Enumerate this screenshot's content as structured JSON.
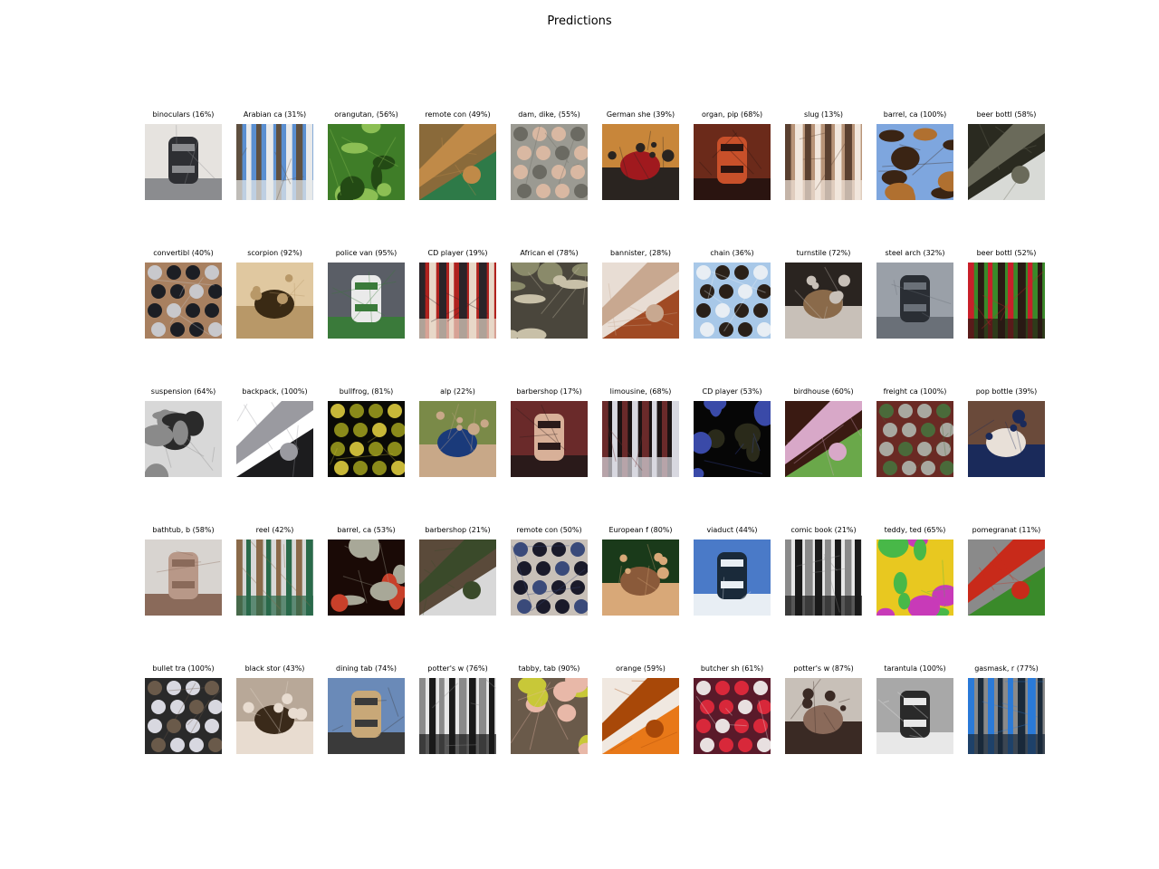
{
  "figure": {
    "title": "Predictions"
  },
  "rows": [
    {
      "items": [
        {
          "label": "binoculars (16%)",
          "image": "binoculars",
          "colors": [
            "#e6e3df",
            "#2e2f33",
            "#8b8c8f"
          ]
        },
        {
          "label": "Arabian ca (31%)",
          "image": "camel-in-desert",
          "colors": [
            "#5a8fd1",
            "#e8e9ea",
            "#5f5040"
          ]
        },
        {
          "label": "orangutan, (56%)",
          "image": "green-pepper-plant",
          "colors": [
            "#3f7d28",
            "#234a14",
            "#8cbf54"
          ]
        },
        {
          "label": "remote con (49%)",
          "image": "man-at-tower",
          "colors": [
            "#8a6a3a",
            "#2e7a48",
            "#c08a48"
          ]
        },
        {
          "label": "dam, dike, (55%)",
          "image": "hand-over-water",
          "colors": [
            "#9b9a92",
            "#d9b8a2",
            "#6b6a62"
          ]
        },
        {
          "label": "German she (39%)",
          "image": "costume-figure",
          "colors": [
            "#c8863a",
            "#a0191e",
            "#2a2420"
          ]
        },
        {
          "label": "organ, pip (68%)",
          "image": "wine-cellar",
          "colors": [
            "#6b2a1a",
            "#c8502a",
            "#2a1410"
          ]
        },
        {
          "label": "slug (13%)",
          "image": "wicker-basket",
          "colors": [
            "#b89478",
            "#f1e6dc",
            "#5a4030"
          ]
        },
        {
          "label": "barrel, ca (100%)",
          "image": "barrel",
          "colors": [
            "#7ea6de",
            "#b07030",
            "#3a2414"
          ]
        },
        {
          "label": "beer bottl (58%)",
          "image": "bottle",
          "colors": [
            "#2a2a20",
            "#d8dad6",
            "#6a6a5a"
          ]
        }
      ]
    },
    {
      "items": [
        {
          "label": "convertibl (40%)",
          "image": "convertible-car",
          "colors": [
            "#a88060",
            "#1c1e24",
            "#c8c8cc"
          ]
        },
        {
          "label": "scorpion (92%)",
          "image": "scorpion",
          "colors": [
            "#e0c8a0",
            "#3a2a14",
            "#b89868"
          ]
        },
        {
          "label": "police van (95%)",
          "image": "van",
          "colors": [
            "#5a5e66",
            "#eaeaea",
            "#3a7a3a"
          ]
        },
        {
          "label": "CD player (19%)",
          "image": "hands-with-cds",
          "colors": [
            "#b0221e",
            "#e8d8c8",
            "#2a2428"
          ]
        },
        {
          "label": "African el (78%)",
          "image": "elephant",
          "colors": [
            "#4a463c",
            "#8a8a6a",
            "#c8c0a8"
          ]
        },
        {
          "label": "bannister, (28%)",
          "image": "wooden-sticks",
          "colors": [
            "#e8ddd4",
            "#a04a24",
            "#c8a890"
          ]
        },
        {
          "label": "chain (36%)",
          "image": "sandals",
          "colors": [
            "#a8c8e8",
            "#2a2018",
            "#e8eef4"
          ]
        },
        {
          "label": "turnstile (72%)",
          "image": "shutter-gate",
          "colors": [
            "#2a2420",
            "#8a6a4a",
            "#c8c0b8"
          ]
        },
        {
          "label": "steel arch (32%)",
          "image": "steel-bridge",
          "colors": [
            "#9aa0a8",
            "#2a2e34",
            "#6a7078"
          ]
        },
        {
          "label": "beer bottl (52%)",
          "image": "soda-bottle",
          "colors": [
            "#3a8a2a",
            "#2a1a14",
            "#c8202a"
          ]
        }
      ]
    },
    {
      "items": [
        {
          "label": "suspension (64%)",
          "image": "suspension-bridge",
          "colors": [
            "#d8d8d8",
            "#2a2a2a",
            "#8a8a8a"
          ]
        },
        {
          "label": "backpack,  (100%)",
          "image": "shoulder-bag",
          "colors": [
            "#ffffff",
            "#1c1c1e",
            "#9a9aa0"
          ]
        },
        {
          "label": "bullfrog,  (81%)",
          "image": "frog-on-leaf",
          "colors": [
            "#0a0a06",
            "#8a8a1a",
            "#c8b838"
          ]
        },
        {
          "label": "alp (22%)",
          "image": "man-with-binoculars",
          "colors": [
            "#7a8a48",
            "#1a3a7a",
            "#c8a888"
          ]
        },
        {
          "label": "barbershop (17%)",
          "image": "crowd",
          "colors": [
            "#6a2a2a",
            "#d8b098",
            "#2a1a1a"
          ]
        },
        {
          "label": "limousine, (68%)",
          "image": "night-car",
          "colors": [
            "#1a1212",
            "#d8d8e0",
            "#6a2a2a"
          ]
        },
        {
          "label": "CD player (53%)",
          "image": "dark-stereo",
          "colors": [
            "#060606",
            "#2a2a1a",
            "#3a4aa8"
          ]
        },
        {
          "label": "birdhouse (60%)",
          "image": "birdhouse",
          "colors": [
            "#3a1a12",
            "#6aa84a",
            "#d8a8c8"
          ]
        },
        {
          "label": "freight ca (100%)",
          "image": "freight-car",
          "colors": [
            "#6a2a24",
            "#a8a8a0",
            "#4a6a3a"
          ]
        },
        {
          "label": "pop bottle (39%)",
          "image": "bottles-on-shelf",
          "colors": [
            "#6a4a3a",
            "#e8e0d8",
            "#1a2a5a"
          ]
        }
      ]
    },
    {
      "items": [
        {
          "label": "bathtub, b (58%)",
          "image": "dogs-in-tub",
          "colors": [
            "#d8d4d0",
            "#b89888",
            "#8a6a5a"
          ]
        },
        {
          "label": "reel (42%)",
          "image": "green-cart",
          "colors": [
            "#d8d8d8",
            "#2a6a4a",
            "#8a6a4a"
          ]
        },
        {
          "label": "barrel, ca (53%)",
          "image": "bar-counter",
          "colors": [
            "#1a0a06",
            "#c8402a",
            "#a8a898"
          ]
        },
        {
          "label": "barbershop (21%)",
          "image": "people-crowd",
          "colors": [
            "#5a4a3a",
            "#d8d8d8",
            "#3a4a2a"
          ]
        },
        {
          "label": "remote con (50%)",
          "image": "mp3-player",
          "colors": [
            "#c8c0b8",
            "#1a1a2a",
            "#3a4a7a"
          ]
        },
        {
          "label": "European f (80%)",
          "image": "spider-on-log",
          "colors": [
            "#1a3a1a",
            "#8a5a3a",
            "#d8a878"
          ]
        },
        {
          "label": "viaduct (44%)",
          "image": "bridge-underside",
          "colors": [
            "#4a7ac8",
            "#1a2a3a",
            "#e8eef4"
          ]
        },
        {
          "label": "comic book (21%)",
          "image": "old-photo",
          "colors": [
            "#e8e8e8",
            "#1a1a1a",
            "#8a8a8a"
          ]
        },
        {
          "label": "teddy, ted (65%)",
          "image": "candle-toy",
          "colors": [
            "#e8c820",
            "#c83ab8",
            "#48b848"
          ]
        },
        {
          "label": "pomegranat (11%)",
          "image": "tomato-plant",
          "colors": [
            "#8a8a8a",
            "#3a8a2a",
            "#c82a1a"
          ]
        }
      ]
    },
    {
      "items": [
        {
          "label": "bullet tra (100%)",
          "image": "train-station",
          "colors": [
            "#2a2a2a",
            "#d8d8e0",
            "#6a5a4a"
          ]
        },
        {
          "label": "black stor (43%)",
          "image": "leaves-ground",
          "colors": [
            "#b8a898",
            "#3a2a1a",
            "#e8dcd0"
          ]
        },
        {
          "label": "dining tab (74%)",
          "image": "dining-room",
          "colors": [
            "#6a8ab8",
            "#c8a878",
            "#3a3a3a"
          ]
        },
        {
          "label": "potter's w (76%)",
          "image": "sandals-bw",
          "colors": [
            "#e8e8e8",
            "#1a1a1a",
            "#8a8a8a"
          ]
        },
        {
          "label": "tabby, tab (90%)",
          "image": "cat-face",
          "colors": [
            "#6a5a4a",
            "#c8c838",
            "#e8b8a8"
          ]
        },
        {
          "label": "orange (59%)",
          "image": "oranges",
          "colors": [
            "#f0e8e0",
            "#e87818",
            "#a84808"
          ]
        },
        {
          "label": "butcher sh (61%)",
          "image": "meat-counter",
          "colors": [
            "#5a1a2a",
            "#d8283a",
            "#e8e0e0"
          ]
        },
        {
          "label": "potter's w (87%)",
          "image": "pottery-wheel",
          "colors": [
            "#c8c0b8",
            "#8a6a5a",
            "#3a2a24"
          ]
        },
        {
          "label": "tarantula (100%)",
          "image": "spider-on-gravel",
          "colors": [
            "#a8a8a8",
            "#2a2a2a",
            "#e8e8e8"
          ]
        },
        {
          "label": "gasmask, r (77%)",
          "image": "goggles-toy",
          "colors": [
            "#8a8a8a",
            "#1a2a3a",
            "#2a7ad8"
          ]
        }
      ]
    }
  ]
}
